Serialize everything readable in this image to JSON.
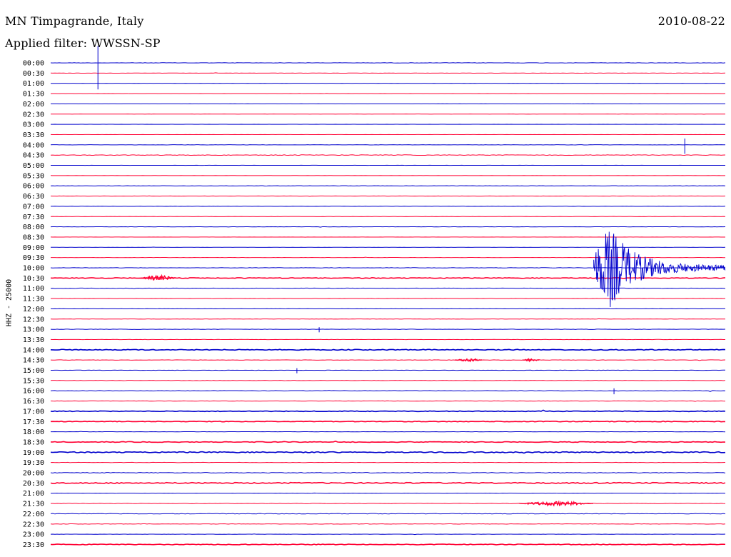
{
  "header": {
    "station": "MN Timpagrande, Italy",
    "date": "2010-08-22",
    "filter": "Applied filter: WWSSN-SP"
  },
  "channel_label": "HHZ - 25000",
  "colors": {
    "trace_blue": "#0000cc",
    "trace_red": "#ff0033",
    "text": "#000000"
  },
  "chart_data": {
    "type": "line",
    "title": "MN Timpagrande, Italy",
    "subtitle": "Applied filter: WWSSN-SP",
    "ylabel": "HHZ - 25000",
    "xlabel": "",
    "row_interval_minutes": 30,
    "row_colors": [
      "blue",
      "red"
    ],
    "y_tick_labels": [
      "00:00",
      "00:30",
      "01:00",
      "01:30",
      "02:00",
      "02:30",
      "03:00",
      "03:30",
      "04:00",
      "04:30",
      "05:00",
      "05:30",
      "06:00",
      "06:30",
      "07:00",
      "07:30",
      "08:00",
      "08:30",
      "09:00",
      "09:30",
      "10:00",
      "10:30",
      "11:00",
      "11:30",
      "12:00",
      "12:30",
      "13:00",
      "13:30",
      "14:00",
      "14:30",
      "15:00",
      "15:30",
      "16:00",
      "16:30",
      "17:00",
      "17:30",
      "18:00",
      "18:30",
      "19:00",
      "19:30",
      "20:00",
      "20:30",
      "21:00",
      "21:30",
      "22:00",
      "22:30",
      "23:00",
      "23:30"
    ],
    "noise_level": [
      0.3,
      0.2,
      0.1,
      0.1,
      0.1,
      0.1,
      0.1,
      0.1,
      0.2,
      0.5,
      0.1,
      0.1,
      0.3,
      0.2,
      0.2,
      0.2,
      0.2,
      0.1,
      0.1,
      0.2,
      0.3,
      0.6,
      0.4,
      0.2,
      0.2,
      0.2,
      0.3,
      0.2,
      0.7,
      0.3,
      0.3,
      0.3,
      0.4,
      0.3,
      0.6,
      0.6,
      0.2,
      0.6,
      0.8,
      0.3,
      0.5,
      0.9,
      0.2,
      0.4,
      0.5,
      0.3,
      0.2,
      0.6
    ],
    "events": [
      {
        "row": 20,
        "x_fraction": 0.805,
        "type": "earthquake",
        "peak_amplitude": 1.0,
        "duration_fraction": 0.195
      },
      {
        "row": 21,
        "x_fraction": 0.135,
        "type": "burst",
        "peak_amplitude": 0.25,
        "duration_fraction": 0.05
      },
      {
        "row": 29,
        "x_fraction": 0.6,
        "type": "burst",
        "peak_amplitude": 0.15,
        "duration_fraction": 0.04
      },
      {
        "row": 29,
        "x_fraction": 0.7,
        "type": "burst",
        "peak_amplitude": 0.12,
        "duration_fraction": 0.025
      },
      {
        "row": 43,
        "x_fraction": 0.695,
        "type": "burst",
        "peak_amplitude": 0.2,
        "duration_fraction": 0.11
      },
      {
        "row": 30,
        "x_fraction": 0.365,
        "type": "spike",
        "peak_amplitude": 0.3
      },
      {
        "row": 32,
        "x_fraction": 0.835,
        "type": "spike",
        "peak_amplitude": 0.35
      },
      {
        "row": 26,
        "x_fraction": 0.398,
        "type": "spike",
        "peak_amplitude": 0.3
      },
      {
        "row": 8,
        "x_fraction": 0.94,
        "type": "spike",
        "peak_amplitude": 0.9
      },
      {
        "row": 0,
        "x_fraction": 0.07,
        "type": "spike",
        "peak_amplitude": 1.4
      }
    ]
  }
}
